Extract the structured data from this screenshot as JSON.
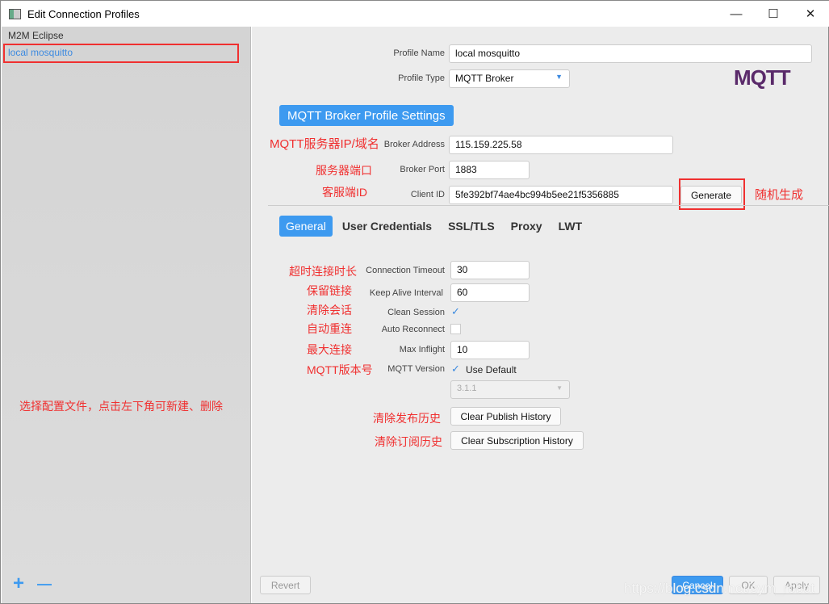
{
  "window": {
    "title": "Edit Connection Profiles",
    "minimize": "—",
    "maximize": "☐",
    "close": "✕"
  },
  "sidebar": {
    "items": [
      {
        "label": "M2M Eclipse"
      },
      {
        "label": "local mosquitto",
        "selected": true
      }
    ],
    "add": "+",
    "remove": "—",
    "annotation": "选择配置文件，点击左下角可新建、删除"
  },
  "profile": {
    "name_label": "Profile Name",
    "name_value": "local mosquitto",
    "type_label": "Profile Type",
    "type_value": "MQTT Broker",
    "logo": "MQTT"
  },
  "broker": {
    "section_title": "MQTT Broker Profile Settings",
    "address_label": "Broker Address",
    "address_value": "115.159.225.58",
    "address_note": "MQTT服务器IP/域名",
    "port_label": "Broker Port",
    "port_value": "1883",
    "port_note": "服务器端口",
    "client_label": "Client ID",
    "client_value": "5fe392bf74ae4bc994b5ee21f5356885",
    "client_note": "客服端ID",
    "generate": "Generate",
    "generate_note": "随机生成"
  },
  "tabs": [
    {
      "label": "General",
      "active": true
    },
    {
      "label": "User Credentials"
    },
    {
      "label": "SSL/TLS"
    },
    {
      "label": "Proxy"
    },
    {
      "label": "LWT"
    }
  ],
  "general": {
    "timeout_label": "Connection Timeout",
    "timeout_value": "30",
    "timeout_note": "超时连接时长",
    "keepalive_label": "Keep Alive Interval",
    "keepalive_value": "60",
    "keepalive_note": "保留链接",
    "clean_label": "Clean Session",
    "clean_checked": true,
    "clean_note": "清除会话",
    "auto_label": "Auto Reconnect",
    "auto_checked": false,
    "auto_note": "自动重连",
    "inflight_label": "Max Inflight",
    "inflight_value": "10",
    "inflight_note": "最大连接",
    "version_label": "MQTT Version",
    "version_default": "Use Default",
    "version_checked": true,
    "version_note": "MQTT版本号",
    "version_value": "3.1.1",
    "clear_pub": "Clear Publish History",
    "clear_pub_note": "清除发布历史",
    "clear_sub": "Clear Subscription History",
    "clear_sub_note": "清除订阅历史"
  },
  "footer": {
    "revert": "Revert",
    "cancel": "Cancel",
    "ok": "OK",
    "apply": "Apply"
  },
  "watermark": "https://blog.csdn.net/sym_robot",
  "colors": {
    "accent": "#3d9af0",
    "annotation": "#f03030",
    "selected_text": "#3d8ae0"
  }
}
